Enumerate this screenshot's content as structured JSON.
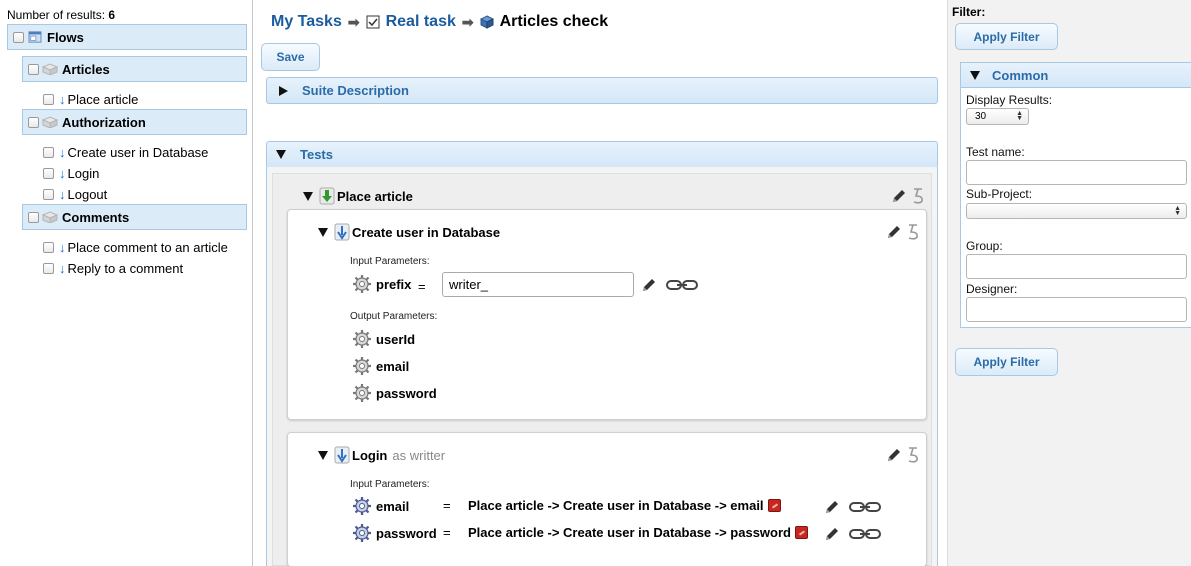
{
  "left": {
    "results_label": "Number of results:",
    "results_count": "6",
    "root_label": "Flows",
    "groups": [
      {
        "label": "Articles",
        "items": [
          "Place article"
        ]
      },
      {
        "label": "Authorization",
        "items": [
          "Create user in Database",
          "Login",
          "Logout"
        ]
      },
      {
        "label": "Comments",
        "items": [
          "Place comment to an article",
          "Reply to a comment"
        ]
      }
    ]
  },
  "breadcrumb": {
    "first": "My Tasks",
    "second": "Real task",
    "current": "Articles check"
  },
  "toolbar": {
    "save_label": "Save"
  },
  "sections": {
    "suite_description": "Suite Description",
    "tests": "Tests"
  },
  "tests": {
    "flow_title": "Place article",
    "steps": [
      {
        "title": "Create user in Database",
        "subtitle": "",
        "input_label": "Input Parameters:",
        "inputs": [
          {
            "name": "prefix",
            "eq": "=",
            "value": "writer_"
          }
        ],
        "output_label": "Output Parameters:",
        "outputs": [
          "userId",
          "email",
          "password"
        ]
      },
      {
        "title": "Login",
        "subtitle": "as writter",
        "input_label": "Input Parameters:",
        "inputs": [
          {
            "name": "email",
            "eq": "=",
            "ref": "Place article -> Create user in Database -> email"
          },
          {
            "name": "password",
            "eq": "=",
            "ref": "Place article -> Create user in Database -> password"
          }
        ]
      }
    ]
  },
  "filter": {
    "title": "Filter:",
    "apply_label": "Apply Filter",
    "common_label": "Common",
    "display_results_label": "Display Results:",
    "display_results_value": "30",
    "test_name_label": "Test name:",
    "subproject_label": "Sub-Project:",
    "group_label": "Group:",
    "designer_label": "Designer:"
  },
  "colors": {
    "link": "#1a5c9f",
    "accent_fill": "#dcebf8",
    "accent_border": "#a9c8e3",
    "error": "#c8271f"
  }
}
